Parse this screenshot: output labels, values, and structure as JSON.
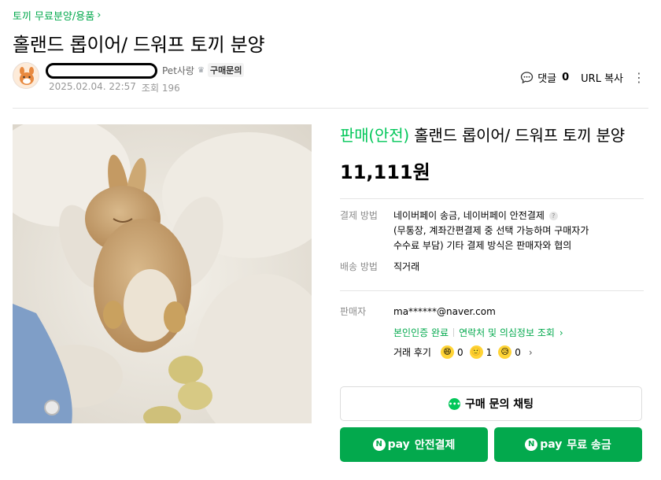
{
  "breadcrumb": {
    "category": "토끼 무료분양/용품"
  },
  "post": {
    "title": "홀랜드 롭이어/ 드워프 토끼 분양",
    "author_nick": "Pet사랑",
    "author_badge": "구매문의",
    "date": "2025.02.04. 22:57",
    "views_label": "조회",
    "views": "196"
  },
  "actions": {
    "comment_label": "댓글",
    "comment_count": "0",
    "url_label": "URL 복사"
  },
  "product": {
    "status": "판매(안전)",
    "title": "홀랜드 롭이어/ 드워프 토끼 분양",
    "price": "11,111원",
    "payment_label": "결제 방법",
    "payment_value_1": "네이버페이 송금, 네이버페이 안전결제",
    "payment_value_2": "(무통장, 계좌간편결제 중 선택 가능하며 구매자가",
    "payment_value_3": "수수료 부담) 기타 결제 방식은 판매자와 협의",
    "shipping_label": "배송 방법",
    "shipping_value": "직거래",
    "seller_label": "판매자",
    "seller_email": "ma******@naver.com",
    "verify_label": "본인인증 완료",
    "contact_label": "연락처 및 의심정보 조회",
    "review_label": "거래 후기",
    "review_counts": [
      "0",
      "1",
      "0"
    ]
  },
  "buttons": {
    "chat": "구매 문의 채팅",
    "npay_brand": "pay",
    "safe_pay": "안전결제",
    "free_send": "무료 송금"
  },
  "colors": {
    "accent": "#03c75a",
    "button_green": "#03a94d"
  },
  "icons": [
    "chevron-right-icon",
    "crown-icon",
    "comment-icon",
    "more-vertical-icon",
    "question-icon",
    "smile-emoji-icon",
    "chat-icon",
    "npay-icon"
  ]
}
